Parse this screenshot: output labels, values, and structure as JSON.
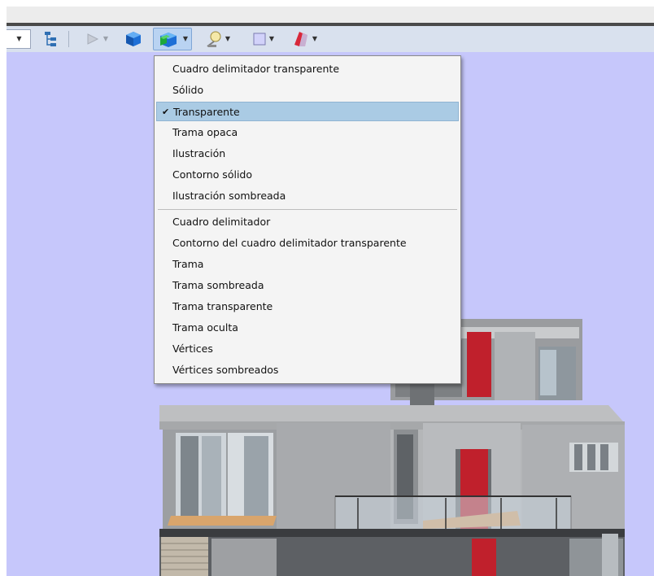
{
  "toolbar": {
    "buttons": [
      {
        "name": "combo-dropdown-arrow",
        "icon": "chevron-down-icon"
      },
      {
        "name": "tree-view-button",
        "icon": "hierarchy-tree-icon"
      },
      {
        "name": "play-button",
        "icon": "play-icon"
      },
      {
        "name": "solid-cube-button",
        "icon": "cube-icon"
      },
      {
        "name": "render-style-button",
        "icon": "render-style-icon"
      },
      {
        "name": "lighting-button",
        "icon": "light-bulb-icon"
      },
      {
        "name": "background-button",
        "icon": "background-square-icon"
      },
      {
        "name": "cross-section-button",
        "icon": "section-icon"
      }
    ]
  },
  "menu": {
    "group1": [
      {
        "label": "Cuadro delimitador transparente",
        "checked": false
      },
      {
        "label": "Sólido",
        "checked": false
      },
      {
        "label": "Transparente",
        "checked": true
      },
      {
        "label": "Trama opaca",
        "checked": false
      },
      {
        "label": "Ilustración",
        "checked": false
      },
      {
        "label": "Contorno sólido",
        "checked": false
      },
      {
        "label": "Ilustración sombreada",
        "checked": false
      }
    ],
    "group2": [
      {
        "label": "Cuadro delimitador",
        "checked": false
      },
      {
        "label": "Contorno del cuadro delimitador transparente",
        "checked": false
      },
      {
        "label": "Trama",
        "checked": false
      },
      {
        "label": "Trama sombreada",
        "checked": false
      },
      {
        "label": "Trama transparente",
        "checked": false
      },
      {
        "label": "Trama oculta",
        "checked": false
      },
      {
        "label": "Vértices",
        "checked": false
      },
      {
        "label": "Vértices sombreados",
        "checked": false
      }
    ],
    "check_glyph": "✔"
  },
  "colors": {
    "viewport_bg": "#c6c7fb",
    "toolbar_bg": "#d9e1ee",
    "menu_selected": "#aacbe4",
    "accent_red": "#c0202c"
  }
}
